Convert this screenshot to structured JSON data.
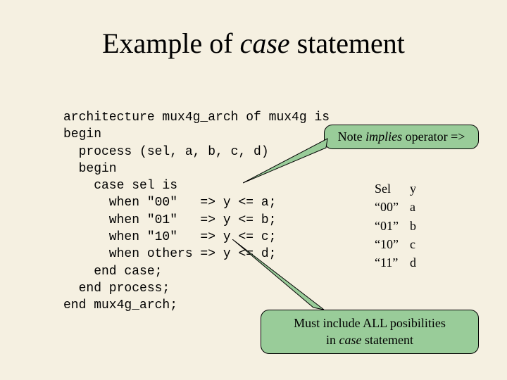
{
  "title_pre": "Example of ",
  "title_italic": "case",
  "title_post": " statement",
  "code": "architecture mux4g_arch of mux4g is\nbegin\n  process (sel, a, b, c, d)\n  begin\n    case sel is\n      when \"00\"   => y <= a;\n      when \"01\"   => y <= b;\n      when \"10\"   => y <= c;\n      when others => y <= d;\n    end case;\n  end process;\nend mux4g_arch;",
  "note1_pre": "Note ",
  "note1_italic": "implies",
  "note1_post": " operator =>",
  "table": {
    "head": {
      "c1": "Sel",
      "c2": "y"
    },
    "rows": [
      {
        "c1": "“00”",
        "c2": "a"
      },
      {
        "c1": "“01”",
        "c2": "b"
      },
      {
        "c1": "“10”",
        "c2": "c"
      },
      {
        "c1": "“11”",
        "c2": "d"
      }
    ]
  },
  "note2_line1_pre": "Must include ALL posibilities",
  "note2_line2_pre": "in ",
  "note2_line2_italic": "case",
  "note2_line2_post": " statement"
}
